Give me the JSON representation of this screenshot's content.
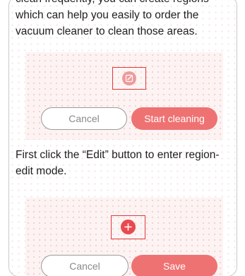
{
  "text": {
    "paragraph_1": "clean frequently, you can create regions which can help you easily to order the vacuum cleaner to clean those areas.",
    "paragraph_2": "First click the “Edit” button to enter region-edit mode."
  },
  "panel_1": {
    "icon": "edit-icon",
    "cancel_label": "Cancel",
    "start_label": "Start cleaning"
  },
  "panel_2": {
    "icon": "plus-icon",
    "cancel_label": "Cancel",
    "save_label": "Save"
  },
  "colors": {
    "accent": "#ef7272",
    "highlight": "#e0393e",
    "panel_bg": "#fdf3f3"
  }
}
